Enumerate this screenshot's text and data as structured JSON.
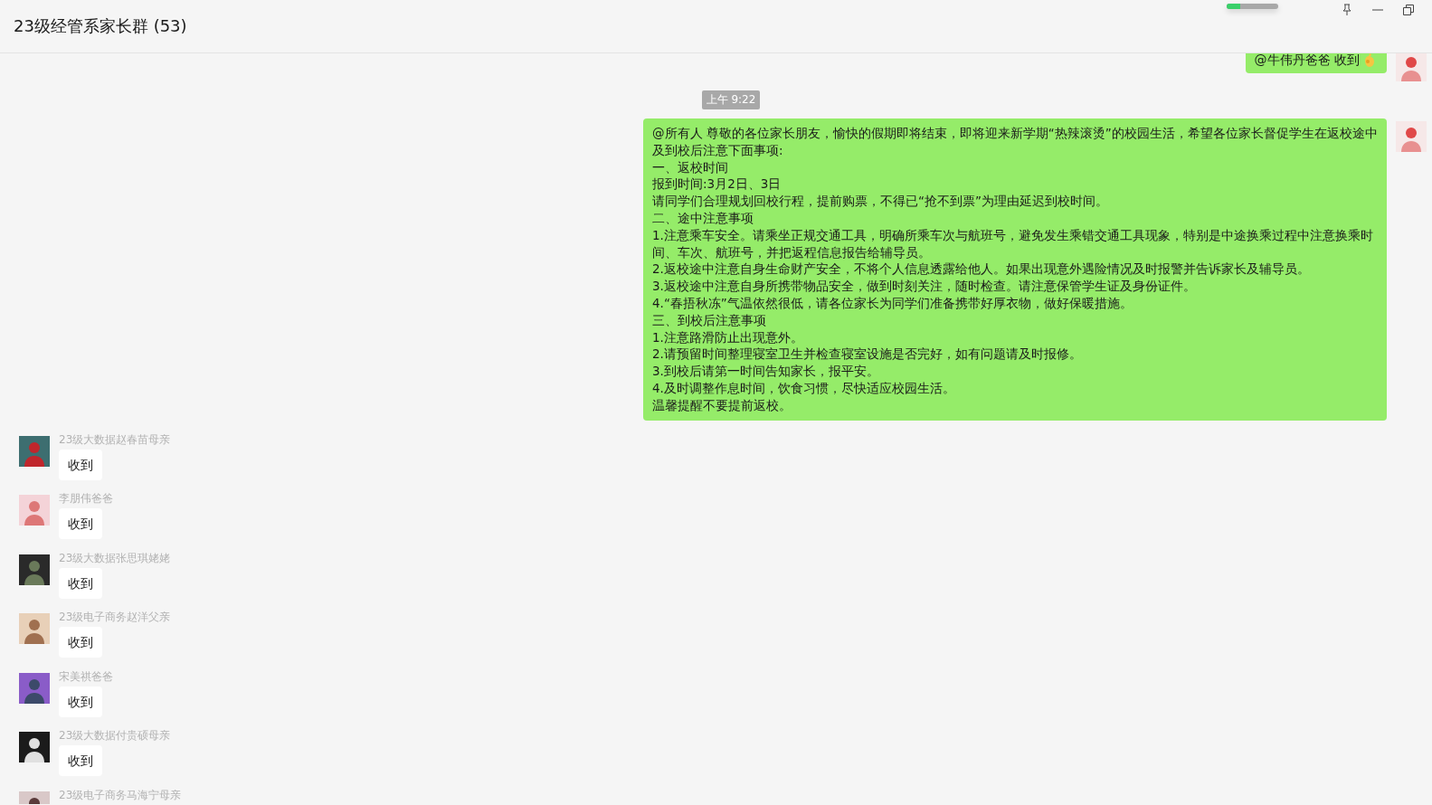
{
  "chat": {
    "title": "23级经管系家长群 (53)"
  },
  "top_indicator": {
    "level": 0.27
  },
  "messages": [
    {
      "kind": "outgoing",
      "text": "@牛伟丹爸爸 收到",
      "has_emoji": true
    },
    {
      "kind": "time",
      "text": "上午 9:22"
    },
    {
      "kind": "outgoing",
      "lines": [
        "@所有人 尊敬的各位家长朋友，愉快的假期即将结束，即将迎来新学期“热辣滚烫”的校园生活，希望各位家长督促学生在返校途中及到校后注意下面事项:",
        "一、返校时间",
        "报到时间:3月2日、3日",
        "请同学们合理规划回校行程，提前购票，不得已“抢不到票”为理由延迟到校时间。",
        "二、途中注意事项",
        "1.注意乘车安全。请乘坐正规交通工具，明确所乘车次与航班号，避免发生乘错交通工具现象，特别是中途换乘过程中注意换乘时间、车次、航班号，并把返程信息报告给辅导员。",
        "2.返校途中注意自身生命财产安全，不将个人信息透露给他人。如果出现意外遇险情况及时报警并告诉家长及辅导员。",
        "3.返校途中注意自身所携带物品安全，做到时刻关注，随时检查。请注意保管学生证及身份证件。",
        "4.“春捂秋冻”气温依然很低，请各位家长为同学们准备携带好厚衣物，做好保暖措施。",
        "三、到校后注意事项",
        "1.注意路滑防止出现意外。",
        "2.请预留时间整理寝室卫生并检查寝室设施是否完好，如有问题请及时报修。",
        "3.到校后请第一时间告知家长，报平安。",
        "4.及时调整作息时间，饮食习惯，尽快适应校园生活。",
        "温馨提醒不要提前返校。"
      ],
      "has_emoji": false
    },
    {
      "kind": "incoming",
      "sender": "23级大数据赵春苗母亲",
      "text": "收到"
    },
    {
      "kind": "incoming",
      "sender": "李朋伟爸爸",
      "text": "收到"
    },
    {
      "kind": "incoming",
      "sender": "23级大数据张思琪姥姥",
      "text": "收到"
    },
    {
      "kind": "incoming",
      "sender": "23级电子商务赵洋父亲",
      "text": "收到"
    },
    {
      "kind": "incoming",
      "sender": "宋美祺爸爸",
      "text": "收到"
    },
    {
      "kind": "incoming",
      "sender": "23级大数据付贵硕母亲",
      "text": "收到"
    },
    {
      "kind": "incoming",
      "sender": "23级电子商务马海宁母亲"
    }
  ]
}
